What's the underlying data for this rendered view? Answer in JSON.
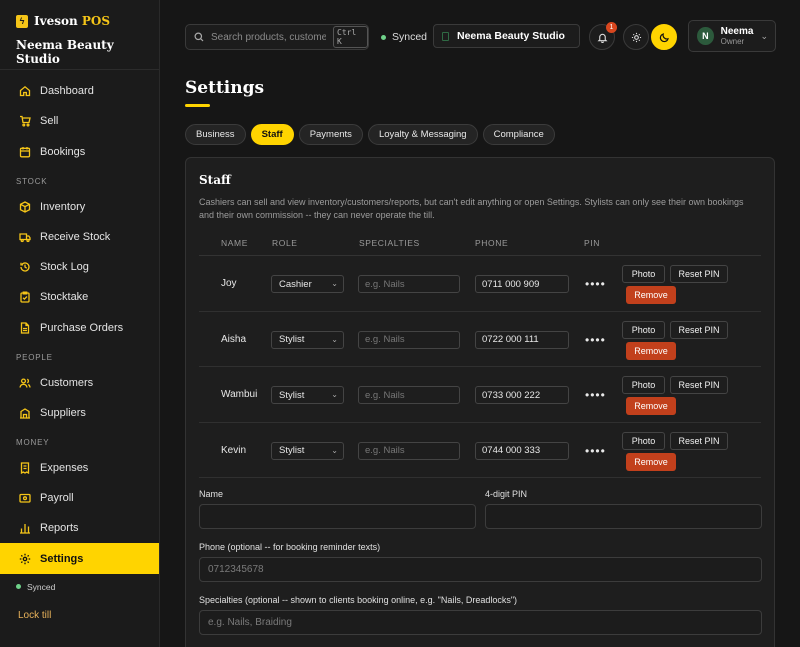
{
  "brand": {
    "name_main": "Iveson",
    "name_accent": "POS",
    "store": "Neema Beauty Studio"
  },
  "sidebar": {
    "items": [
      {
        "label": "Dashboard",
        "icon": "home-icon"
      },
      {
        "label": "Sell",
        "icon": "cart-icon"
      },
      {
        "label": "Bookings",
        "icon": "calendar-icon"
      }
    ],
    "sections": [
      {
        "title": "STOCK",
        "items": [
          {
            "label": "Inventory",
            "icon": "box-icon"
          },
          {
            "label": "Receive Stock",
            "icon": "truck-icon"
          },
          {
            "label": "Stock Log",
            "icon": "history-icon"
          },
          {
            "label": "Stocktake",
            "icon": "clipboard-icon"
          },
          {
            "label": "Purchase Orders",
            "icon": "document-icon"
          }
        ]
      },
      {
        "title": "PEOPLE",
        "items": [
          {
            "label": "Customers",
            "icon": "users-icon"
          },
          {
            "label": "Suppliers",
            "icon": "building-icon"
          }
        ]
      },
      {
        "title": "MONEY",
        "items": [
          {
            "label": "Expenses",
            "icon": "receipt-icon"
          },
          {
            "label": "Payroll",
            "icon": "wallet-icon"
          },
          {
            "label": "Reports",
            "icon": "bar-chart-icon"
          },
          {
            "label": "Settings",
            "icon": "gear-icon",
            "active": true
          }
        ]
      }
    ],
    "synced": "Synced",
    "lock": "Lock till"
  },
  "topbar": {
    "search_placeholder": "Search products, customers...",
    "shortcut": "Ctrl K",
    "synced": "Synced",
    "store": "Neema Beauty Studio",
    "notifications": "1",
    "user": {
      "initial": "N",
      "name": "Neema",
      "role": "Owner"
    }
  },
  "page": {
    "title": "Settings"
  },
  "tabs": [
    "Business",
    "Staff",
    "Payments",
    "Loyalty & Messaging",
    "Compliance"
  ],
  "active_tab": "Staff",
  "staff": {
    "title": "Staff",
    "description": "Cashiers can sell and view inventory/customers/reports, but can't edit anything or open Settings. Stylists can only see their own bookings and their own commission -- they can never operate the till.",
    "columns": [
      "NAME",
      "ROLE",
      "SPECIALTIES",
      "PHONE",
      "PIN"
    ],
    "rows": [
      {
        "name": "Joy",
        "role": "Cashier",
        "specialties_placeholder": "e.g. Nails",
        "phone": "0711 000 909",
        "pin": "••••"
      },
      {
        "name": "Aisha",
        "role": "Stylist",
        "specialties_placeholder": "e.g. Nails",
        "phone": "0722 000 111",
        "pin": "••••"
      },
      {
        "name": "Wambui",
        "role": "Stylist",
        "specialties_placeholder": "e.g. Nails",
        "phone": "0733 000 222",
        "pin": "••••"
      },
      {
        "name": "Kevin",
        "role": "Stylist",
        "specialties_placeholder": "e.g. Nails",
        "phone": "0744 000 333",
        "pin": "••••"
      }
    ],
    "buttons": {
      "photo": "Photo",
      "reset_pin": "Reset PIN",
      "remove": "Remove"
    },
    "form": {
      "name_label": "Name",
      "pin_label": "4-digit PIN",
      "phone_label": "Phone (optional -- for booking reminder texts)",
      "phone_placeholder": "0712345678",
      "specialties_label": "Specialties (optional -- shown to clients booking online, e.g. \"Nails, Dreadlocks\")",
      "specialties_placeholder": "e.g. Nails, Braiding"
    }
  },
  "colors": {
    "accent": "#ffd400",
    "danger": "#c2401c",
    "success": "#6fd28a",
    "background": "#161616"
  }
}
